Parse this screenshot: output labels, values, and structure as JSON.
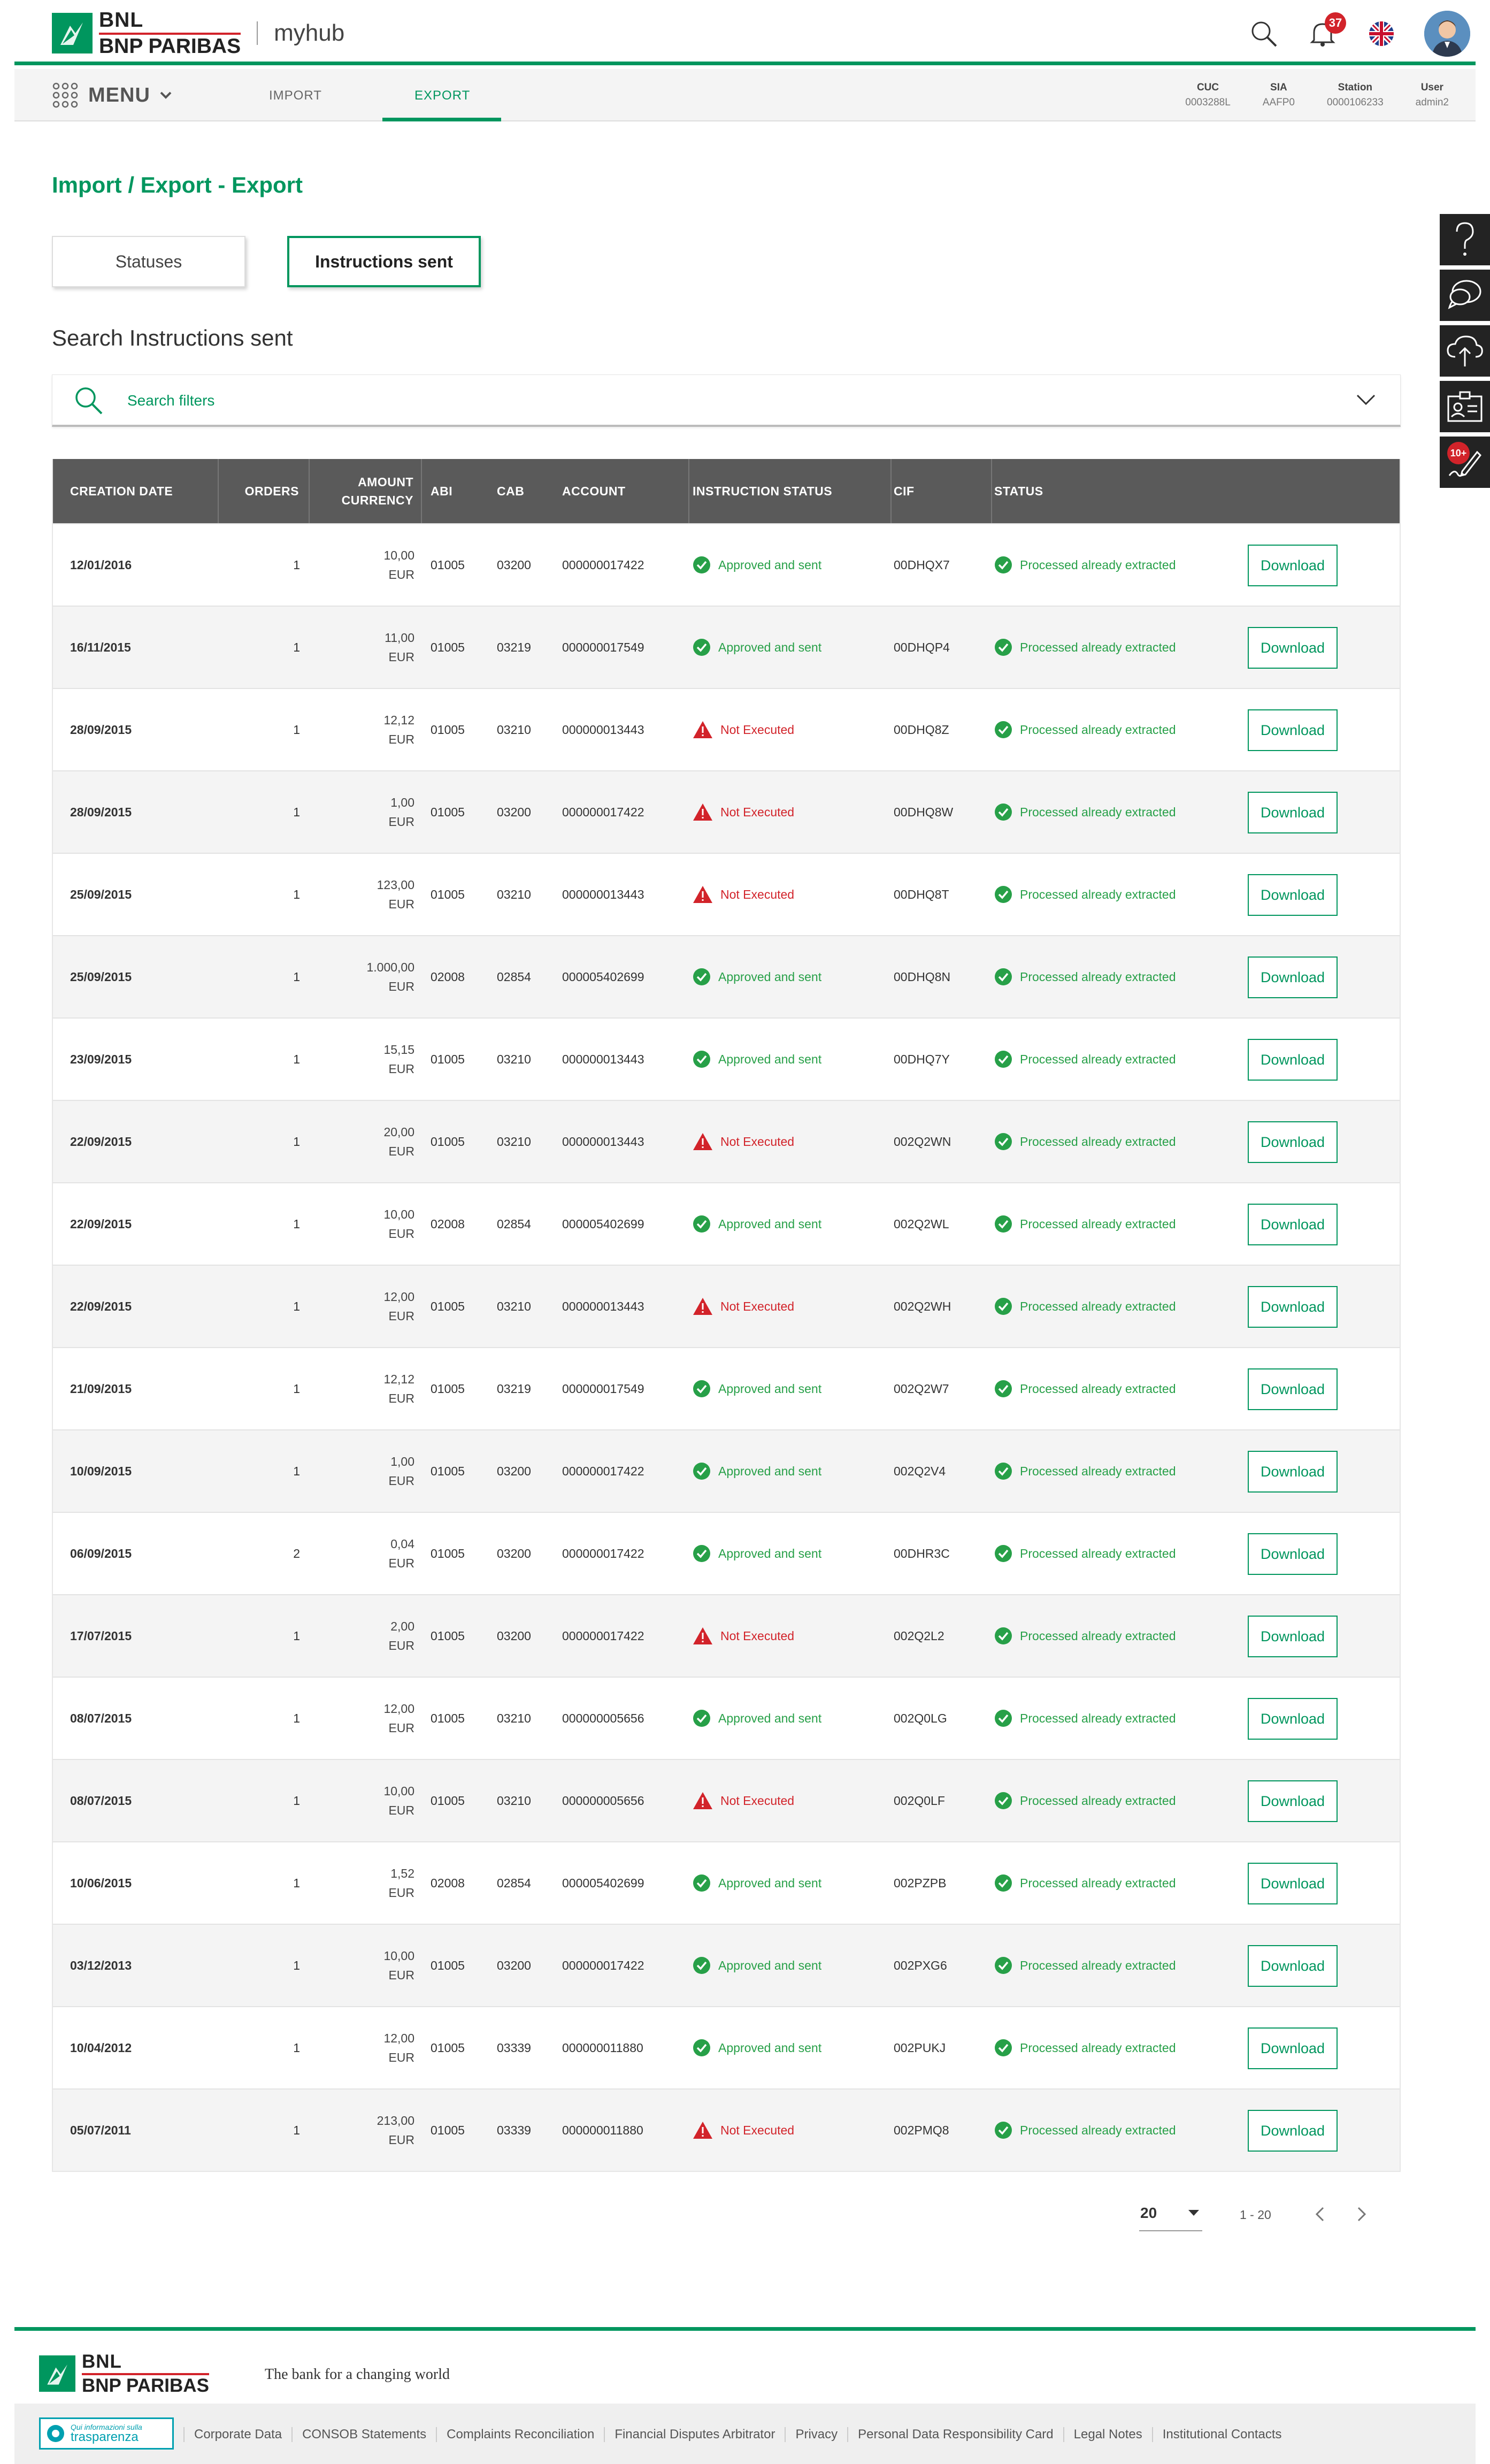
{
  "header": {
    "brand_line1": "BNL",
    "brand_line2": "BNP PARIBAS",
    "app_name": "myhub",
    "notifications_count": "37",
    "icons": [
      "search-icon",
      "bell-icon",
      "uk-flag-icon",
      "user-avatar"
    ]
  },
  "menubar": {
    "menu_label": "MENU",
    "tabs": [
      {
        "label": "IMPORT",
        "active": false
      },
      {
        "label": "EXPORT",
        "active": true
      }
    ],
    "info": [
      {
        "key": "CUC",
        "value": "0003288L"
      },
      {
        "key": "SIA",
        "value": "AAFP0"
      },
      {
        "key": "Station",
        "value": "0000106233"
      },
      {
        "key": "User",
        "value": "admin2"
      }
    ]
  },
  "page": {
    "title": "Import / Export - Export",
    "tab_statuses": "Statuses",
    "tab_instructions_sent": "Instructions sent",
    "search_title": "Search Instructions sent",
    "search_filters": "Search filters"
  },
  "table": {
    "headers": {
      "creation_date": "CREATION DATE",
      "orders": "ORDERS",
      "amount_line1": "AMOUNT",
      "amount_line2": "CURRENCY",
      "abi": "ABI",
      "cab": "CAB",
      "account": "ACCOUNT",
      "instruction_status": "INSTRUCTION STATUS",
      "cif": "CIF",
      "status": "STATUS"
    },
    "download_label": "Download",
    "rows": [
      {
        "date": "12/01/2016",
        "orders": "1",
        "amount": "10,00",
        "currency": "EUR",
        "abi": "01005",
        "cab": "03200",
        "account": "000000017422",
        "instr_ok": true,
        "instr_status": "Approved and sent",
        "cif": "00DHQX7",
        "status": "Processed already extracted"
      },
      {
        "date": "16/11/2015",
        "orders": "1",
        "amount": "11,00",
        "currency": "EUR",
        "abi": "01005",
        "cab": "03219",
        "account": "000000017549",
        "instr_ok": true,
        "instr_status": "Approved and sent",
        "cif": "00DHQP4",
        "status": "Processed already extracted"
      },
      {
        "date": "28/09/2015",
        "orders": "1",
        "amount": "12,12",
        "currency": "EUR",
        "abi": "01005",
        "cab": "03210",
        "account": "000000013443",
        "instr_ok": false,
        "instr_status": "Not Executed",
        "cif": "00DHQ8Z",
        "status": "Processed already extracted"
      },
      {
        "date": "28/09/2015",
        "orders": "1",
        "amount": "1,00",
        "currency": "EUR",
        "abi": "01005",
        "cab": "03200",
        "account": "000000017422",
        "instr_ok": false,
        "instr_status": "Not Executed",
        "cif": "00DHQ8W",
        "status": "Processed already extracted"
      },
      {
        "date": "25/09/2015",
        "orders": "1",
        "amount": "123,00",
        "currency": "EUR",
        "abi": "01005",
        "cab": "03210",
        "account": "000000013443",
        "instr_ok": false,
        "instr_status": "Not Executed",
        "cif": "00DHQ8T",
        "status": "Processed already extracted"
      },
      {
        "date": "25/09/2015",
        "orders": "1",
        "amount": "1.000,00",
        "currency": "EUR",
        "abi": "02008",
        "cab": "02854",
        "account": "000005402699",
        "instr_ok": true,
        "instr_status": "Approved and sent",
        "cif": "00DHQ8N",
        "status": "Processed already extracted"
      },
      {
        "date": "23/09/2015",
        "orders": "1",
        "amount": "15,15",
        "currency": "EUR",
        "abi": "01005",
        "cab": "03210",
        "account": "000000013443",
        "instr_ok": true,
        "instr_status": "Approved and sent",
        "cif": "00DHQ7Y",
        "status": "Processed already extracted"
      },
      {
        "date": "22/09/2015",
        "orders": "1",
        "amount": "20,00",
        "currency": "EUR",
        "abi": "01005",
        "cab": "03210",
        "account": "000000013443",
        "instr_ok": false,
        "instr_status": "Not Executed",
        "cif": "002Q2WN",
        "status": "Processed already extracted"
      },
      {
        "date": "22/09/2015",
        "orders": "1",
        "amount": "10,00",
        "currency": "EUR",
        "abi": "02008",
        "cab": "02854",
        "account": "000005402699",
        "instr_ok": true,
        "instr_status": "Approved and sent",
        "cif": "002Q2WL",
        "status": "Processed already extracted"
      },
      {
        "date": "22/09/2015",
        "orders": "1",
        "amount": "12,00",
        "currency": "EUR",
        "abi": "01005",
        "cab": "03210",
        "account": "000000013443",
        "instr_ok": false,
        "instr_status": "Not Executed",
        "cif": "002Q2WH",
        "status": "Processed already extracted"
      },
      {
        "date": "21/09/2015",
        "orders": "1",
        "amount": "12,12",
        "currency": "EUR",
        "abi": "01005",
        "cab": "03219",
        "account": "000000017549",
        "instr_ok": true,
        "instr_status": "Approved and sent",
        "cif": "002Q2W7",
        "status": "Processed already extracted"
      },
      {
        "date": "10/09/2015",
        "orders": "1",
        "amount": "1,00",
        "currency": "EUR",
        "abi": "01005",
        "cab": "03200",
        "account": "000000017422",
        "instr_ok": true,
        "instr_status": "Approved and sent",
        "cif": "002Q2V4",
        "status": "Processed already extracted"
      },
      {
        "date": "06/09/2015",
        "orders": "2",
        "amount": "0,04",
        "currency": "EUR",
        "abi": "01005",
        "cab": "03200",
        "account": "000000017422",
        "instr_ok": true,
        "instr_status": "Approved and sent",
        "cif": "00DHR3C",
        "status": "Processed already extracted"
      },
      {
        "date": "17/07/2015",
        "orders": "1",
        "amount": "2,00",
        "currency": "EUR",
        "abi": "01005",
        "cab": "03200",
        "account": "000000017422",
        "instr_ok": false,
        "instr_status": "Not Executed",
        "cif": "002Q2L2",
        "status": "Processed already extracted"
      },
      {
        "date": "08/07/2015",
        "orders": "1",
        "amount": "12,00",
        "currency": "EUR",
        "abi": "01005",
        "cab": "03210",
        "account": "000000005656",
        "instr_ok": true,
        "instr_status": "Approved and sent",
        "cif": "002Q0LG",
        "status": "Processed already extracted"
      },
      {
        "date": "08/07/2015",
        "orders": "1",
        "amount": "10,00",
        "currency": "EUR",
        "abi": "01005",
        "cab": "03210",
        "account": "000000005656",
        "instr_ok": false,
        "instr_status": "Not Executed",
        "cif": "002Q0LF",
        "status": "Processed already extracted"
      },
      {
        "date": "10/06/2015",
        "orders": "1",
        "amount": "1,52",
        "currency": "EUR",
        "abi": "02008",
        "cab": "02854",
        "account": "000005402699",
        "instr_ok": true,
        "instr_status": "Approved and sent",
        "cif": "002PZPB",
        "status": "Processed already extracted"
      },
      {
        "date": "03/12/2013",
        "orders": "1",
        "amount": "10,00",
        "currency": "EUR",
        "abi": "01005",
        "cab": "03200",
        "account": "000000017422",
        "instr_ok": true,
        "instr_status": "Approved and sent",
        "cif": "002PXG6",
        "status": "Processed already extracted"
      },
      {
        "date": "10/04/2012",
        "orders": "1",
        "amount": "12,00",
        "currency": "EUR",
        "abi": "01005",
        "cab": "03339",
        "account": "000000011880",
        "instr_ok": true,
        "instr_status": "Approved and sent",
        "cif": "002PUKJ",
        "status": "Processed already extracted"
      },
      {
        "date": "05/07/2011",
        "orders": "1",
        "amount": "213,00",
        "currency": "EUR",
        "abi": "01005",
        "cab": "03339",
        "account": "000000011880",
        "instr_ok": false,
        "instr_status": "Not Executed",
        "cif": "002PMQ8",
        "status": "Processed already extracted"
      }
    ]
  },
  "pagination": {
    "page_size": "20",
    "range": "1 - 20"
  },
  "side_toolbar": {
    "buttons": [
      "help-icon",
      "chat-icon",
      "cloud-upload-icon",
      "contact-card-icon",
      "signature-icon"
    ],
    "signature_badge": "10+"
  },
  "footer": {
    "brand_line1": "BNL",
    "brand_line2": "BNP PARIBAS",
    "tagline": "The bank for a changing world",
    "transparency_line1": "Qui informazioni sulla",
    "transparency_line2": "trasparenza",
    "links": [
      "Corporate Data",
      "CONSOB Statements",
      "Complaints Reconciliation",
      "Financial Disputes Arbitrator",
      "Privacy",
      "Personal Data Responsibility Card",
      "Legal Notes",
      "Institutional Contacts"
    ]
  },
  "colors": {
    "brand_green": "#00965e",
    "status_green": "#27a048",
    "error_red": "#d2232a",
    "table_header": "#5a5a5a"
  }
}
